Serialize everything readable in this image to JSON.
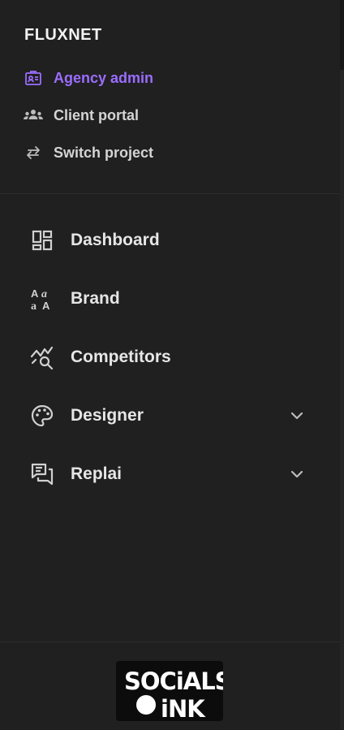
{
  "app": {
    "title": "FLUXNET"
  },
  "top_links": [
    {
      "label": "Agency admin",
      "icon": "badge-icon",
      "active": true
    },
    {
      "label": "Client portal",
      "icon": "users-icon",
      "active": false
    },
    {
      "label": "Switch project",
      "icon": "swap-arrows-icon",
      "active": false
    }
  ],
  "nav": [
    {
      "label": "Dashboard",
      "icon": "dashboard-icon",
      "expandable": false
    },
    {
      "label": "Brand",
      "icon": "typography-icon",
      "expandable": false
    },
    {
      "label": "Competitors",
      "icon": "trend-search-icon",
      "expandable": false
    },
    {
      "label": "Designer",
      "icon": "palette-icon",
      "expandable": true
    },
    {
      "label": "Replai",
      "icon": "chat-bubbles-icon",
      "expandable": true
    }
  ],
  "footer": {
    "logo_text_top": "SOCiALS",
    "logo_text_bottom": "iNK"
  },
  "colors": {
    "accent": "#9b6dff",
    "background": "#202020",
    "text": "#e6e6e6"
  }
}
